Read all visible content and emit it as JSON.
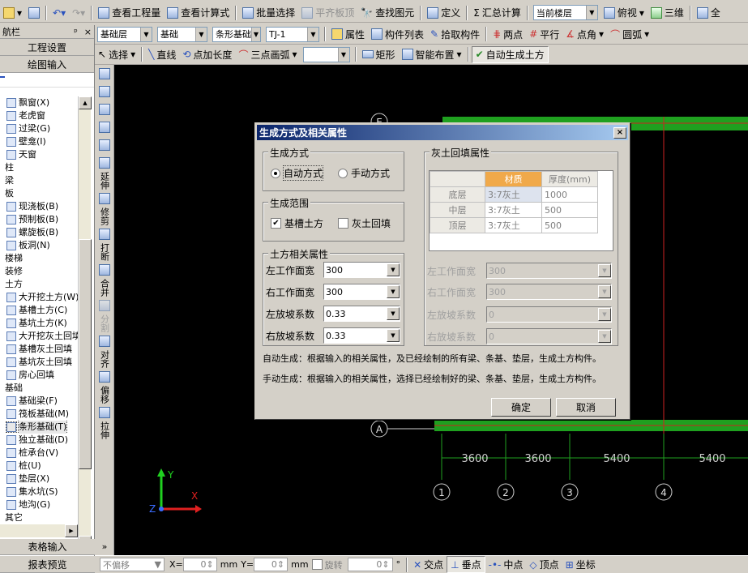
{
  "toolbar1": {
    "view_qty": "查看工程量",
    "view_formula": "查看计算式",
    "batch_select": "批量选择",
    "flush_slab": "平齐板顶",
    "find_element": "查找图元",
    "define": "定义",
    "sum_calc": "汇总计算",
    "floor_select": "当前楼层",
    "top_view": "俯视",
    "three_d": "三维",
    "more": "全"
  },
  "toolbar2": {
    "layer": "基础层",
    "type": "基础",
    "subtype": "条形基础",
    "code": "TJ-1",
    "attr": "属性",
    "elem_list": "构件列表",
    "pick": "拾取构件",
    "two_points": "两点",
    "parallel": "平行",
    "point_angle": "点角",
    "arc": "圆弧"
  },
  "toolbar3": {
    "select": "选择",
    "line": "直线",
    "point_len": "点加长度",
    "three_arc": "三点画弧",
    "rect": "矩形",
    "smart_layout": "智能布置",
    "auto_gen": "自动生成土方"
  },
  "nav": {
    "title": "航栏",
    "pin": "ᵖ",
    "close": "×",
    "project_setup": "工程设置",
    "drawing_input": "绘图输入",
    "table_input": "表格输入",
    "report_preview": "报表预览"
  },
  "tree": [
    "飘窗(X)",
    "老虎窗",
    "过梁(G)",
    "壁龛(I)",
    "天窗",
    "柱",
    "梁",
    "板",
    "现浇板(B)",
    "预制板(B)",
    "螺旋板(B)",
    "板洞(N)",
    "楼梯",
    "装修",
    "土方",
    "大开挖土方(W)",
    "基槽土方(C)",
    "基坑土方(K)",
    "大开挖灰土回填",
    "基槽灰土回填",
    "基坑灰土回填",
    "房心回填",
    "基础",
    "基础梁(F)",
    "筏板基础(M)",
    "条形基础(T)",
    "独立基础(D)",
    "桩承台(V)",
    "桩(U)",
    "垫层(X)",
    "集水坑(S)",
    "地沟(G)",
    "其它"
  ],
  "vtools": {
    "extend": "延伸",
    "trim": "修剪",
    "break": "打断",
    "merge": "合并",
    "split": "分割",
    "align": "对齐",
    "offset": "偏移",
    "stretch": "拉伸"
  },
  "canvas": {
    "axis_top": "E",
    "axis_a": "A",
    "dims": [
      "3600",
      "3600",
      "5400",
      "5400"
    ],
    "axes": [
      "1",
      "2",
      "3",
      "4"
    ],
    "ucs_x": "X",
    "ucs_y": "Y",
    "ucs_z": "Z"
  },
  "dialog": {
    "title": "生成方式及相关属性",
    "close": "×",
    "gen_method": "生成方式",
    "auto": "自动方式",
    "manual": "手动方式",
    "gen_range": "生成范围",
    "trench": "基槽土方",
    "backfill": "灰土回填",
    "earth_props": "土方相关属性",
    "backfill_props": "灰土回填属性",
    "labels": [
      "左工作面宽",
      "右工作面宽",
      "左放坡系数",
      "右放坡系数"
    ],
    "earth_values": [
      "300",
      "300",
      "0.33",
      "0.33"
    ],
    "backfill_values": [
      "300",
      "300",
      "0",
      "0"
    ],
    "table_head": [
      "材质",
      "厚度(mm)"
    ],
    "table_rows": [
      {
        "layer": "底层",
        "material": "3:7灰土",
        "thick": "1000"
      },
      {
        "layer": "中层",
        "material": "3:7灰土",
        "thick": "500"
      },
      {
        "layer": "顶层",
        "material": "3:7灰土",
        "thick": "500"
      }
    ],
    "note_auto": "自动生成：根据输入的相关属性，及已经绘制的所有梁、条基、垫层，生成土方构件。",
    "note_manual": "手动生成：根据输入的相关属性，选择已经绘制好的梁、条基、垫层，生成土方构件。",
    "ok": "确定",
    "cancel": "取消"
  },
  "status": {
    "no_offset": "不偏移",
    "x_label": "X=",
    "x_val": "0",
    "mm1": "mm",
    "y_label": "Y=",
    "y_val": "0",
    "mm2": "mm",
    "rotate": "旋转",
    "rot_val": "0",
    "deg": "°",
    "intersect": "交点",
    "perp": "垂点",
    "mid": "中点",
    "vertex": "顶点",
    "coord": "坐标"
  },
  "colors": {
    "dialog_title_start": "#0a246a",
    "dialog_title_end": "#a6caf0",
    "table_header": "#f0a94a",
    "beam_green": "#1fa01f",
    "axis_red": "#cc2222",
    "canvas": "#000000"
  }
}
